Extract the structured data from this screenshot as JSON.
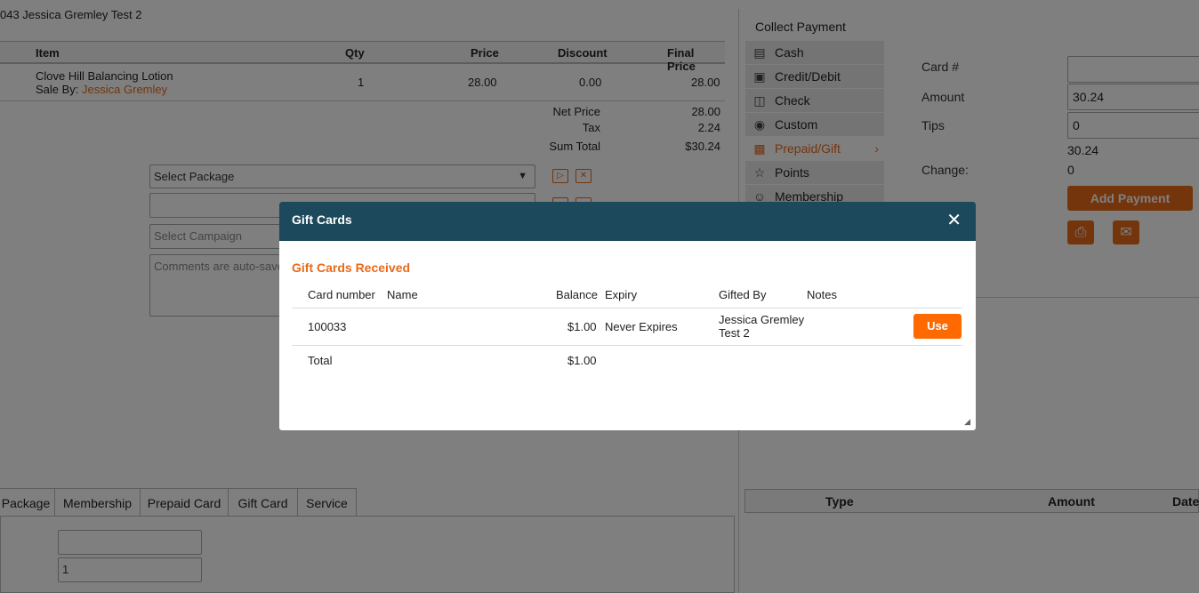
{
  "patient": {
    "text": "043  Jessica Gremley Test 2"
  },
  "items_table": {
    "headers": [
      "Item",
      "Qty",
      "Price",
      "Discount",
      "Final Price"
    ],
    "row": {
      "item": "Clove Hill Balancing Lotion",
      "sale_by_label": "Sale By:",
      "sale_by_name": "Jessica Gremley",
      "qty": "1",
      "price": "28.00",
      "discount": "0.00",
      "final_price": "28.00"
    },
    "totals": [
      {
        "label": "Net Price",
        "value": "28.00"
      },
      {
        "label": "Tax",
        "value": "2.24"
      },
      {
        "label": "Sum Total",
        "value": "$30.24"
      }
    ]
  },
  "form": {
    "package_select": "Select Package",
    "campaign_placeholder": "Select Campaign",
    "comments_placeholder": "Comments are auto-saved"
  },
  "bottom_tabs": [
    "Package",
    "Membership",
    "Prepaid Card",
    "Gift Card",
    "Service"
  ],
  "bottom_fields": {
    "qty": "1"
  },
  "payment": {
    "title": "Collect Payment",
    "methods": [
      {
        "label": "Cash",
        "icon": "cash-icon"
      },
      {
        "label": "Credit/Debit",
        "icon": "card-icon"
      },
      {
        "label": "Check",
        "icon": "check-icon"
      },
      {
        "label": "Custom",
        "icon": "custom-icon"
      },
      {
        "label": "Prepaid/Gift",
        "icon": "gift-icon"
      },
      {
        "label": "Points",
        "icon": "star-icon"
      },
      {
        "label": "Membership",
        "icon": "membership-icon"
      }
    ],
    "card_label": "Card #",
    "amount_label": "Amount",
    "amount_value": "30.24",
    "tips_label": "Tips",
    "tips_value": "0",
    "total_value": "30.24",
    "change_label": "Change:",
    "change_value": "0",
    "add_payment": "Add Payment",
    "history_headers": [
      "Type",
      "Amount",
      "Date"
    ]
  },
  "modal": {
    "title": "Gift Cards",
    "section_title": "Gift Cards Received",
    "headers": [
      "Card number",
      "Name",
      "Balance",
      "Expiry",
      "Gifted By",
      "Notes"
    ],
    "rows": [
      {
        "card_number": "100033",
        "name": "",
        "balance": "$1.00",
        "expiry": "Never Expires",
        "gifted_by_1": "Jessica Gremley",
        "gifted_by_2": "Test 2",
        "notes": "",
        "action": "Use"
      }
    ],
    "total_label": "Total",
    "total_value": "$1.00"
  },
  "colors": {
    "accent": "#e86a1a",
    "modal_header": "#1c4a5c",
    "use_button": "#ff6a00"
  }
}
